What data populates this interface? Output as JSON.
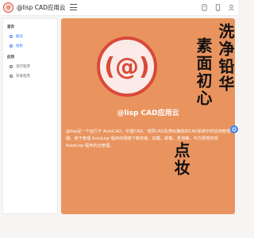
{
  "header": {
    "logo_text": "@",
    "title": "@lisp CAD应用云",
    "icons": [
      "menu-icon",
      "document-icon",
      "mobile-icon",
      "user-icon"
    ]
  },
  "sidebar": {
    "section_home": "首页",
    "home_items": [
      {
        "label": "概览",
        "active": true
      },
      {
        "label": "搜索",
        "active": true
      }
    ],
    "section_apps": "应用",
    "app_items": [
      {
        "label": "流行程序",
        "active": false
      },
      {
        "label": "开发程序",
        "active": false
      }
    ]
  },
  "main": {
    "background": "#e9945f",
    "logo_text": "(@)",
    "calligraphy_col1": "洗净铅华",
    "calligraphy_col2": "素面初心",
    "calligraphy_col3": "点妆",
    "product_name": "@lisp CAD应用云",
    "description": "@lisp是一个运行于 AutoCAD、中望CAD、浩辰CAD及类似兼容的CAD系统中的应用管理器。用于管理 AutoLisp 程序的网络下载安装、加载、卸载、查询等。可方便地实现 AutoLisp 程序的云管理。"
  },
  "colors": {
    "accent": "#3e84f0",
    "brand_red": "#d94a38",
    "main_bg": "#e9945f"
  }
}
